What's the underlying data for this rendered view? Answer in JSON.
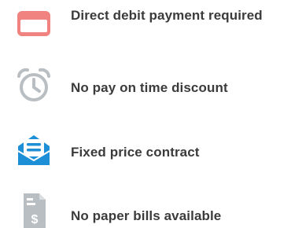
{
  "features": [
    {
      "icon": "credit-card-icon",
      "label": "Direct debit payment required",
      "color": "#f0837f"
    },
    {
      "icon": "alarm-clock-icon",
      "label": "No pay on time discount",
      "color": "#b9bec3"
    },
    {
      "icon": "envelope-letter-icon",
      "label": "Fixed price contract",
      "color": "#1d8fd6"
    },
    {
      "icon": "dollar-bill-icon",
      "label": "No paper bills available",
      "color": "#b9bec3"
    }
  ]
}
